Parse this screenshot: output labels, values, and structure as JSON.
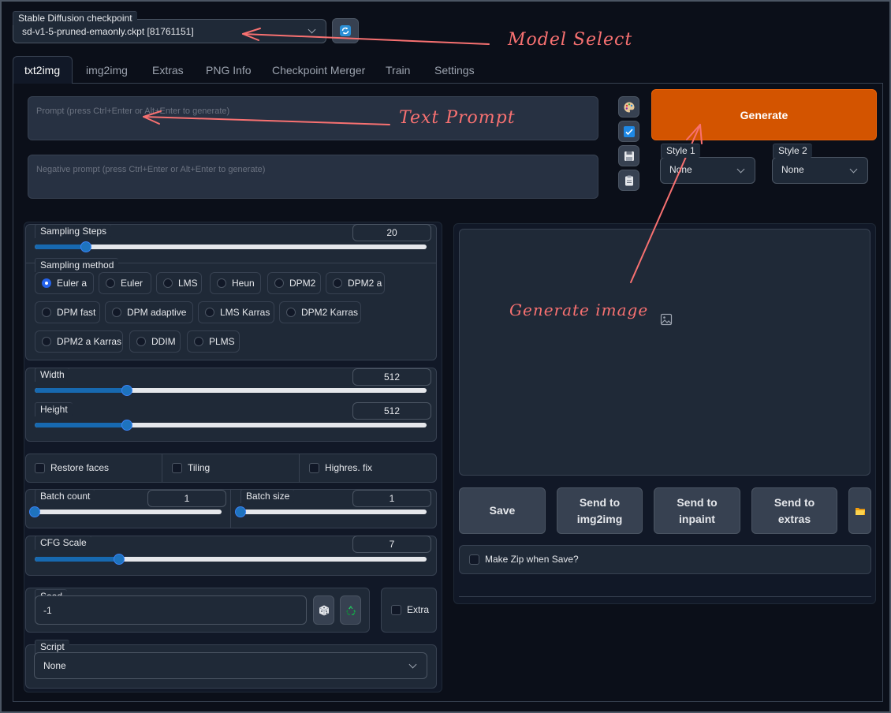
{
  "checkpoint": {
    "label": "Stable Diffusion checkpoint",
    "value": "sd-v1-5-pruned-emaonly.ckpt [81761151]"
  },
  "tabs": [
    "txt2img",
    "img2img",
    "Extras",
    "PNG Info",
    "Checkpoint Merger",
    "Train",
    "Settings"
  ],
  "prompt": {
    "placeholder": "Prompt (press Ctrl+Enter or Alt+Enter to generate)"
  },
  "negative_prompt": {
    "placeholder": "Negative prompt (press Ctrl+Enter or Alt+Enter to generate)"
  },
  "generate_label": "Generate",
  "style1": {
    "label": "Style 1",
    "value": "None"
  },
  "style2": {
    "label": "Style 2",
    "value": "None"
  },
  "sampling_steps": {
    "label": "Sampling Steps",
    "value": "20",
    "fraction": 0.13
  },
  "sampling_method": {
    "label": "Sampling method",
    "options": [
      "Euler a",
      "Euler",
      "LMS",
      "Heun",
      "DPM2",
      "DPM2 a",
      "DPM fast",
      "DPM adaptive",
      "LMS Karras",
      "DPM2 Karras",
      "DPM2 a Karras",
      "DDIM",
      "PLMS"
    ],
    "selected": "Euler a"
  },
  "width": {
    "label": "Width",
    "value": "512",
    "fraction": 0.235
  },
  "height": {
    "label": "Height",
    "value": "512",
    "fraction": 0.235
  },
  "options": {
    "restore_faces": "Restore faces",
    "tiling": "Tiling",
    "highres_fix": "Highres. fix"
  },
  "batch_count": {
    "label": "Batch count",
    "value": "1",
    "fraction": 0.0
  },
  "batch_size": {
    "label": "Batch size",
    "value": "1",
    "fraction": 0.0
  },
  "cfg_scale": {
    "label": "CFG Scale",
    "value": "7",
    "fraction": 0.215
  },
  "seed": {
    "label": "Seed",
    "value": "-1"
  },
  "extra_label": "Extra",
  "script": {
    "label": "Script",
    "value": "None"
  },
  "actions": {
    "save": "Save",
    "send_img2img": "Send to img2img",
    "send_inpaint": "Send to inpaint",
    "send_extras": "Send to extras"
  },
  "make_zip_label": "Make Zip when Save?",
  "annotations": {
    "model_select": "Model Select",
    "text_prompt": "Text Prompt",
    "generate_image": "Generate image"
  },
  "colors": {
    "background": "#0b0f19",
    "panel": "#1f2937",
    "generate": "#d35400",
    "accent": "#1e73be",
    "annotation": "#f87171"
  }
}
